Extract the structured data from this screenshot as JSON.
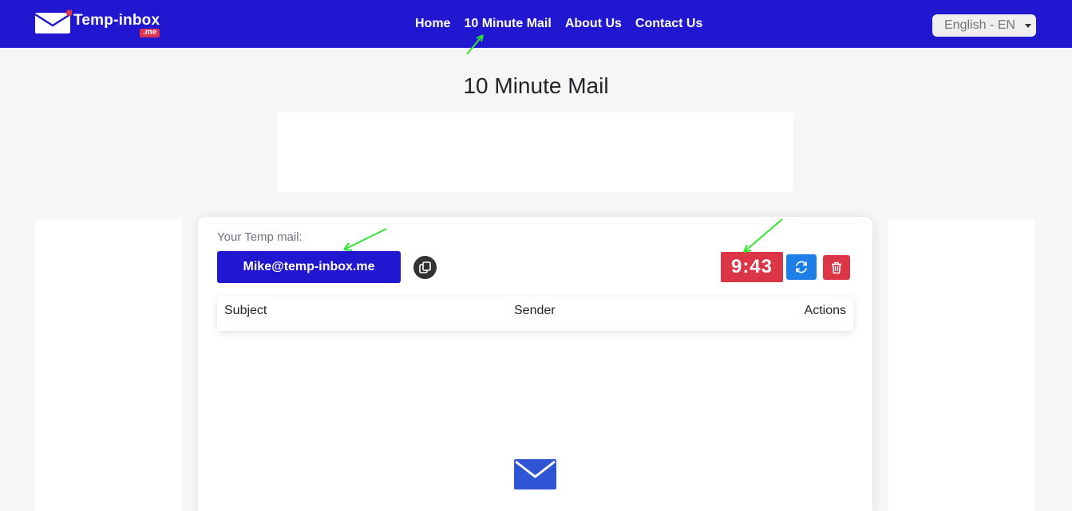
{
  "header": {
    "logo_name": "Temp-inbox",
    "logo_tld": ".me",
    "nav": [
      "Home",
      "10 Minute Mail",
      "About Us",
      "Contact Us"
    ],
    "language": "English - EN"
  },
  "main": {
    "title": "10 Minute Mail",
    "temp_mail_label": "Your Temp mail:",
    "email": "Mike@temp-inbox.me",
    "timer": "9:43",
    "table_headers": {
      "subject": "Subject",
      "sender": "Sender",
      "actions": "Actions"
    }
  },
  "icons": {
    "logo": "envelope-icon",
    "copy": "copy-icon",
    "refresh": "refresh-icon",
    "delete": "trash-icon",
    "empty_inbox": "envelope-icon",
    "annotation": "arrow-icon"
  },
  "colors": {
    "nav_bg": "#2217d0",
    "email_button": "#2217d0",
    "timer": "#dc3545",
    "refresh_button": "#1e7fe8",
    "delete_button": "#dc3545",
    "annotation_arrow": "#2ee82e",
    "empty_inbox_icon": "#2f55d4"
  }
}
